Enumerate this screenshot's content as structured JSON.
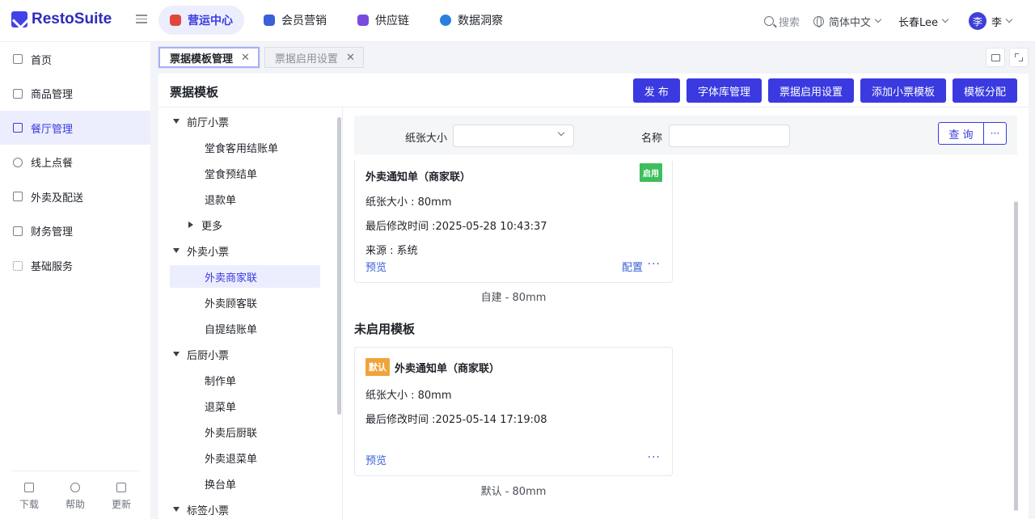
{
  "app": {
    "name": "RestoSuite"
  },
  "topnav": [
    {
      "label": "营运中心",
      "color": "#e0473c"
    },
    {
      "label": "会员营销",
      "color": "#3a5fd8"
    },
    {
      "label": "供应链",
      "color": "#7a4ae0"
    },
    {
      "label": "数据洞察",
      "color": "#2a7fe0"
    }
  ],
  "header": {
    "search": "搜索",
    "language": "简体中文",
    "store": "长春Lee",
    "avatar_char": "李",
    "user": "李"
  },
  "sidebar": {
    "items": [
      {
        "label": "首页"
      },
      {
        "label": "商品管理"
      },
      {
        "label": "餐厅管理"
      },
      {
        "label": "线上点餐"
      },
      {
        "label": "外卖及配送"
      },
      {
        "label": "财务管理"
      },
      {
        "label": "基础服务"
      }
    ],
    "footer": [
      {
        "label": "下载"
      },
      {
        "label": "帮助"
      },
      {
        "label": "更新"
      }
    ]
  },
  "tabs": [
    {
      "label": "票据模板管理",
      "close": "✕"
    },
    {
      "label": "票据启用设置",
      "close": "✕"
    }
  ],
  "panel": {
    "title": "票据模板",
    "actions": [
      "发 布",
      "字体库管理",
      "票据启用设置",
      "添加小票模板",
      "模板分配"
    ]
  },
  "tree": [
    {
      "label": "前厅小票",
      "level": 1
    },
    {
      "label": "堂食客用结账单",
      "level": 2
    },
    {
      "label": "堂食预结单",
      "level": 2
    },
    {
      "label": "退款单",
      "level": 2
    },
    {
      "label": "更多",
      "level": 2
    },
    {
      "label": "外卖小票",
      "level": 1
    },
    {
      "label": "外卖商家联",
      "level": 2
    },
    {
      "label": "外卖顾客联",
      "level": 2
    },
    {
      "label": "自提结账单",
      "level": 2
    },
    {
      "label": "后厨小票",
      "level": 1
    },
    {
      "label": "制作单",
      "level": 2
    },
    {
      "label": "退菜单",
      "level": 2
    },
    {
      "label": "外卖后厨联",
      "level": 2
    },
    {
      "label": "外卖退菜单",
      "level": 2
    },
    {
      "label": "换台单",
      "level": 2
    },
    {
      "label": "标签小票",
      "level": 1
    }
  ],
  "filter": {
    "paper_label": "纸张大小",
    "name_label": "名称",
    "query": "查 询",
    "more": "···"
  },
  "enabled_card": {
    "title": "外卖通知单（商家联）",
    "badge": "启用",
    "paper": "纸张大小 : 80mm",
    "modified": "最后修改时间 :2025-05-28 10:43:37",
    "source": "来源 : 系统",
    "preview": "预览",
    "config": "配置",
    "more": "···",
    "caption": "自建 - 80mm"
  },
  "disabled_section": "未启用模板",
  "disabled_card": {
    "badge": "默认",
    "title": "外卖通知单（商家联）",
    "paper": "纸张大小 : 80mm",
    "modified": "最后修改时间 :2025-05-14 17:19:08",
    "preview": "预览",
    "more": "···",
    "caption": "默认 - 80mm"
  }
}
